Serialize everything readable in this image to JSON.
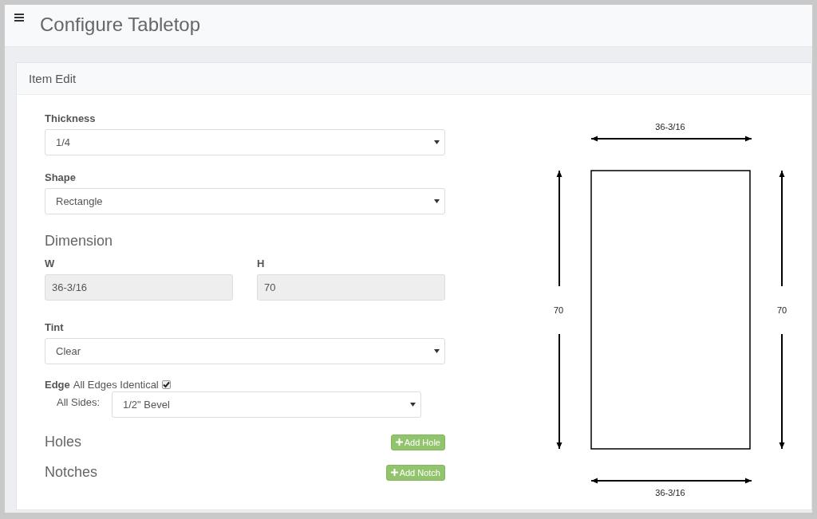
{
  "header": {
    "title": "Configure Tabletop"
  },
  "panel": {
    "title": "Item Edit"
  },
  "form": {
    "thickness": {
      "label": "Thickness",
      "value": "1/4"
    },
    "shape": {
      "label": "Shape",
      "value": "Rectangle"
    },
    "dimension": {
      "heading": "Dimension",
      "width": {
        "label": "W",
        "value": "36-3/16",
        "disabled": true
      },
      "height": {
        "label": "H",
        "value": "70",
        "disabled": true
      }
    },
    "tint": {
      "label": "Tint",
      "value": "Clear"
    },
    "edge": {
      "label": "Edge",
      "identical_label": "All Edges Identical",
      "identical_checked": true,
      "all_sides_label": "All Sides:",
      "all_sides_value": "1/2\" Bevel"
    },
    "holes": {
      "heading": "Holes",
      "button": "Add Hole"
    },
    "notches": {
      "heading": "Notches",
      "button": "Add Notch"
    }
  },
  "drawing": {
    "top_label": "36-3/16",
    "bottom_label": "36-3/16",
    "left_label": "70",
    "right_label": "70"
  }
}
